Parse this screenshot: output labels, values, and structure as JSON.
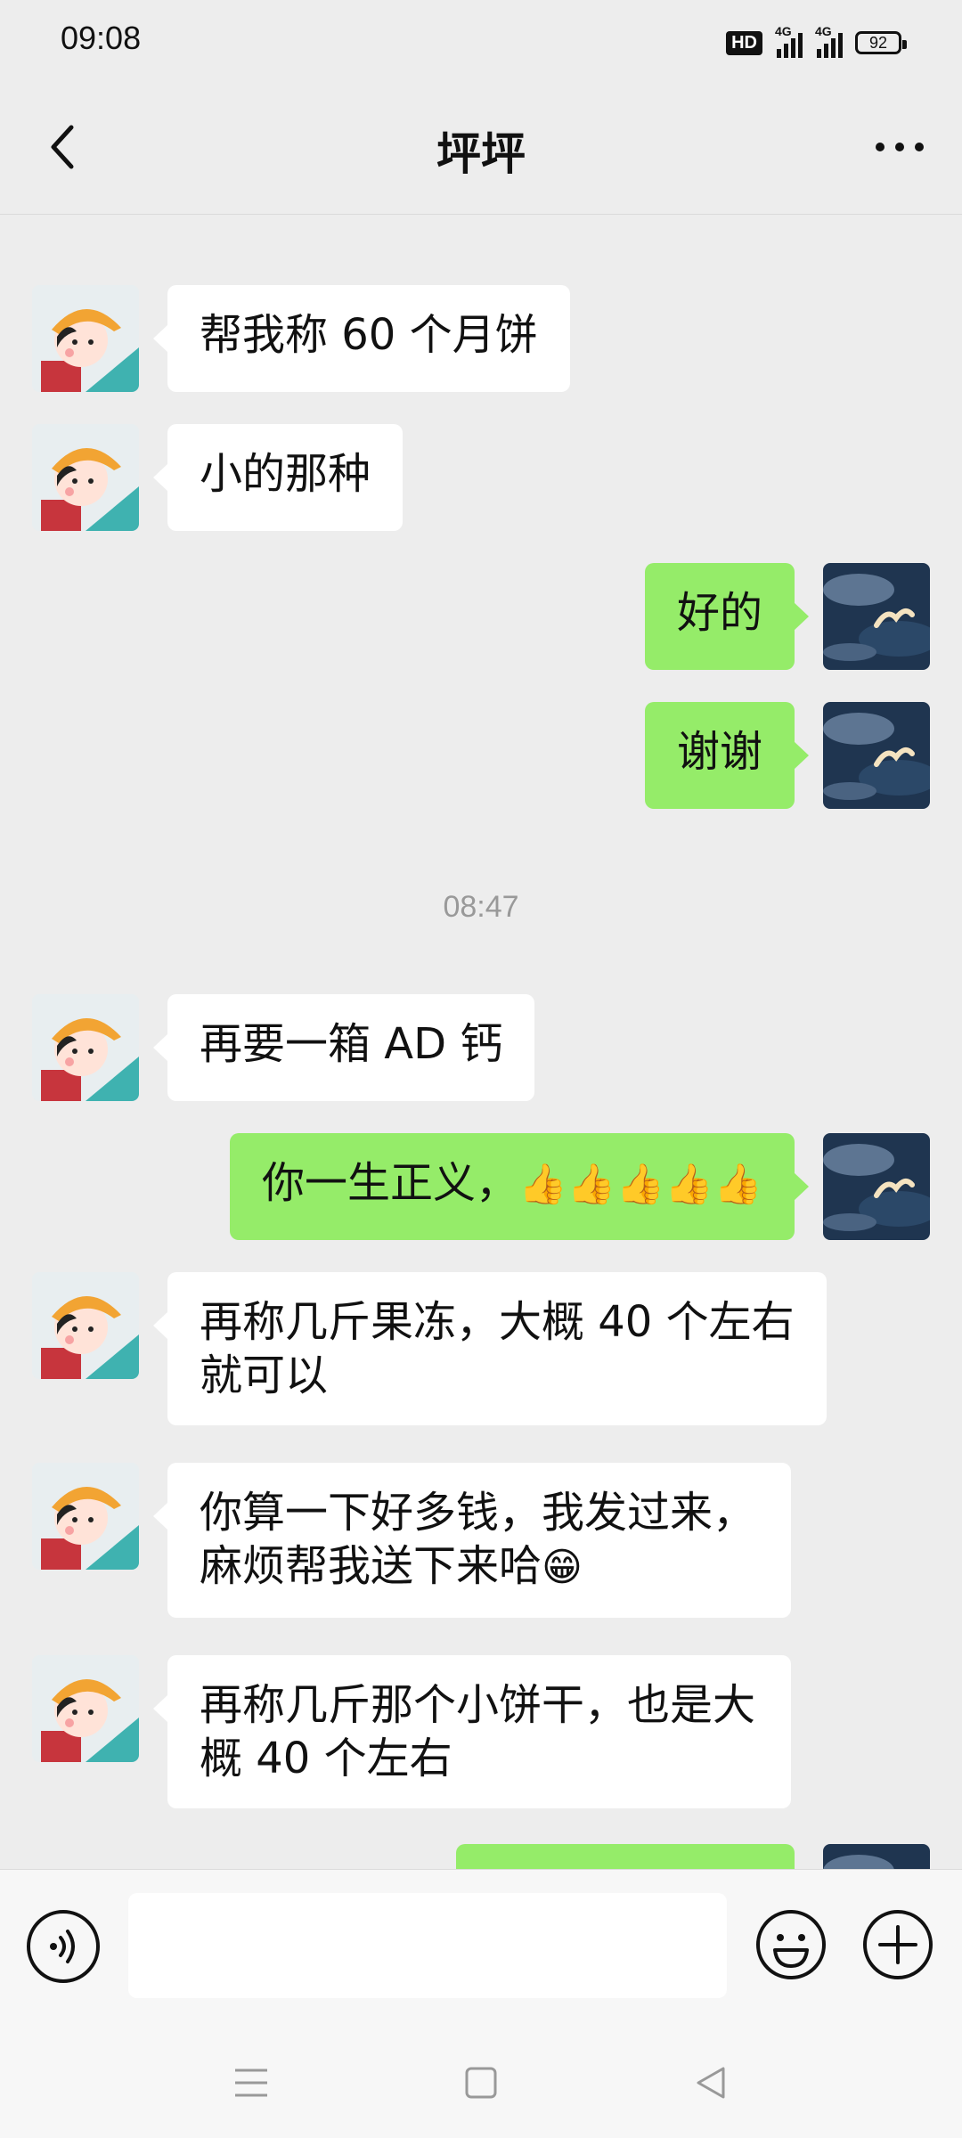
{
  "status_bar": {
    "time": "09:08",
    "hd_label": "HD",
    "network1": "4G",
    "network2": "4G",
    "battery": "92"
  },
  "header": {
    "title": "坪坪",
    "back_icon": "chevron-left-icon",
    "more_icon": "more-dots-icon"
  },
  "messages": [
    {
      "side": "left",
      "text": "帮我称 60 个月饼"
    },
    {
      "side": "left",
      "text": "小的那种"
    },
    {
      "side": "right",
      "text": "好的"
    },
    {
      "side": "right",
      "text": "谢谢"
    },
    {
      "side": "left",
      "text": "再要一箱 AD 钙"
    },
    {
      "side": "right",
      "text": "你一生正义，",
      "emoji": "👍👍👍👍👍"
    },
    {
      "side": "left",
      "text": "再称几斤果冻，大概 40 个左右就可以"
    },
    {
      "side": "left",
      "text": "你算一下好多钱，我发过来，麻烦帮我送下来哈",
      "emoji": "😁"
    },
    {
      "side": "left",
      "text": "再称几斤那个小饼干，也是大概 40 个左右"
    },
    {
      "side": "right",
      "text": ""
    }
  ],
  "timestamp": "08:47",
  "input": {
    "value": "",
    "placeholder": ""
  },
  "colors": {
    "background": "#ededed",
    "bubble_self": "#95ec69",
    "bubble_other": "#ffffff"
  },
  "navigation": [
    "menu-icon",
    "home-square-icon",
    "back-triangle-icon"
  ]
}
